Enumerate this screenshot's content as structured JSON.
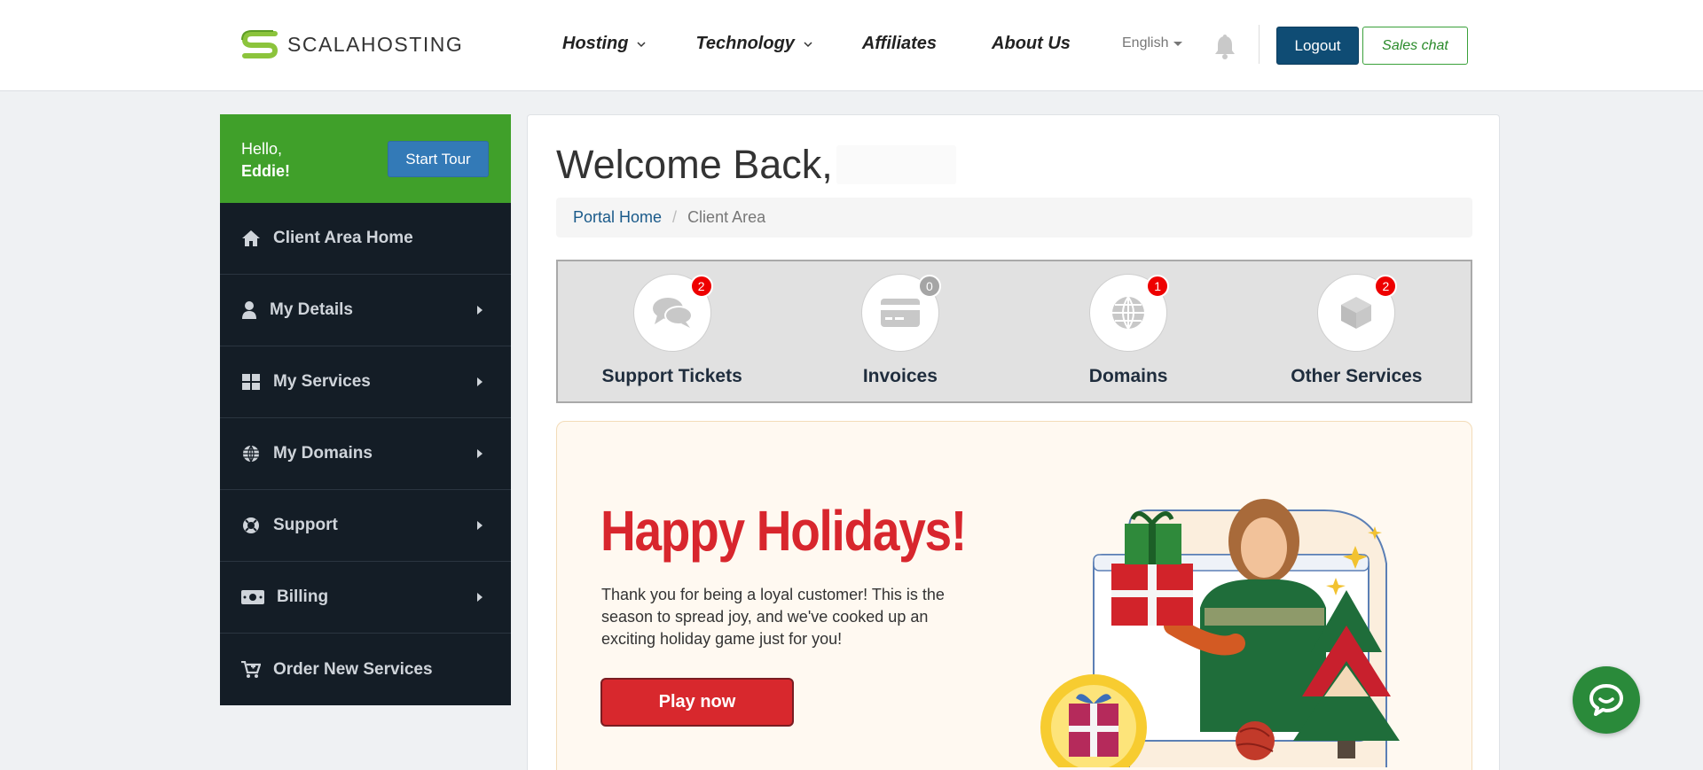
{
  "header": {
    "logo_text": "SCALAHOSTING",
    "nav": [
      {
        "label": "Hosting",
        "has_dropdown": true
      },
      {
        "label": "Technology",
        "has_dropdown": true
      },
      {
        "label": "Affiliates",
        "has_dropdown": false
      },
      {
        "label": "About Us",
        "has_dropdown": false
      }
    ],
    "language": "English",
    "logout_label": "Logout",
    "sales_chat_label": "Sales chat"
  },
  "sidebar": {
    "hello": "Hello,",
    "name": "Eddie!",
    "start_tour_label": "Start Tour",
    "items": [
      {
        "label": "Client Area Home",
        "icon": "home-icon",
        "has_arrow": false
      },
      {
        "label": "My Details",
        "icon": "user-icon",
        "has_arrow": true
      },
      {
        "label": "My Services",
        "icon": "grid-icon",
        "has_arrow": true
      },
      {
        "label": "My Domains",
        "icon": "globe-icon",
        "has_arrow": true
      },
      {
        "label": "Support",
        "icon": "lifebuoy-icon",
        "has_arrow": true
      },
      {
        "label": "Billing",
        "icon": "money-icon",
        "has_arrow": true
      },
      {
        "label": "Order New Services",
        "icon": "cart-icon",
        "has_arrow": false
      }
    ]
  },
  "main": {
    "welcome": "Welcome Back,",
    "breadcrumb": {
      "home": "Portal Home",
      "current": "Client Area"
    },
    "tiles": [
      {
        "label": "Support Tickets",
        "count": "2",
        "icon": "comments-icon"
      },
      {
        "label": "Invoices",
        "count": "0",
        "icon": "credit-card-icon"
      },
      {
        "label": "Domains",
        "count": "1",
        "icon": "globe-icon"
      },
      {
        "label": "Other Services",
        "count": "2",
        "icon": "cube-icon"
      }
    ],
    "promo": {
      "title": "Happy Holidays!",
      "text": "Thank you for being a loyal customer! This is the season to spread joy, and we've cooked up an exciting holiday game just for you!",
      "button": "Play now"
    }
  },
  "colors": {
    "brand_green": "#40a02a",
    "sidebar_dark": "#141d26",
    "logout_blue": "#0f4c74",
    "promo_red": "#d8262d",
    "badge_red": "#ee0000"
  }
}
